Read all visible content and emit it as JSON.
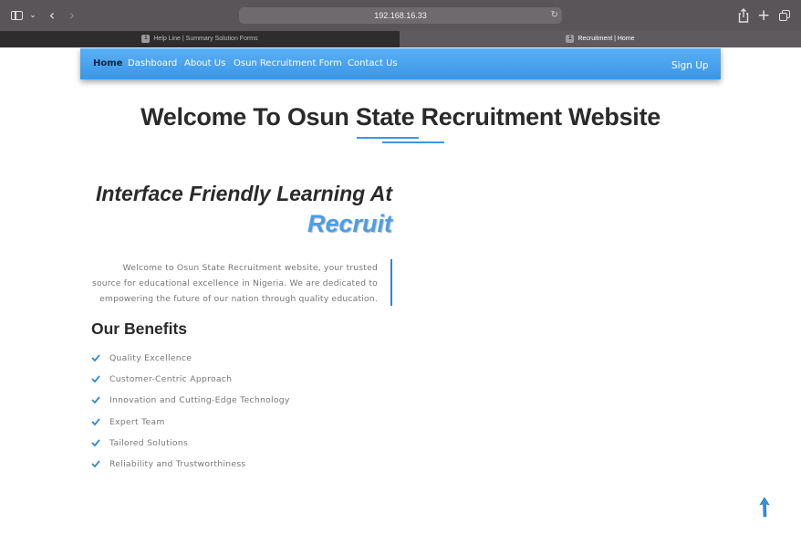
{
  "browser": {
    "url": "192.168.16.33",
    "tabs": [
      {
        "badge": "1",
        "title": "Help Line | Summary Solution Forms"
      },
      {
        "badge": "1",
        "title": "Recruitment | Home"
      }
    ]
  },
  "nav": {
    "items": [
      "Home",
      "Dashboard",
      "About Us",
      "Osun Recruitment Form",
      "Contact Us"
    ],
    "signup": "Sign Up"
  },
  "hero": {
    "title_prefix": "Welcome To ",
    "title_strong": "Osun State Recruitment Website"
  },
  "intro": {
    "subheading": "Interface Friendly Learning At",
    "brand": "Recruit",
    "text": "Welcome to Osun State Recruitment website, your trusted source for educational excellence in Nigeria. We are dedicated to empowering the future of our nation through quality education."
  },
  "benefits": {
    "title": "Our Benefits",
    "items": [
      "Quality Excellence",
      "Customer-Centric Approach",
      "Innovation and Cutting-Edge Technology",
      "Expert Team",
      "Tailored Solutions",
      "Reliability and Trustworthiness"
    ]
  },
  "colors": {
    "accent": "#3a96e8",
    "brand_text": "#4a9ee8",
    "check": "#2f8ad8",
    "chrome": "#5a5558"
  },
  "icons": {
    "sidebar": "sidebar-icon",
    "back": "chevron-left-icon",
    "forward": "chevron-right-icon",
    "reload": "reload-icon",
    "share": "share-icon",
    "new_tab": "plus-icon",
    "tab_overview": "tabs-icon",
    "benefit_bullet": "check-icon",
    "scroll_top": "arrow-up-icon"
  }
}
